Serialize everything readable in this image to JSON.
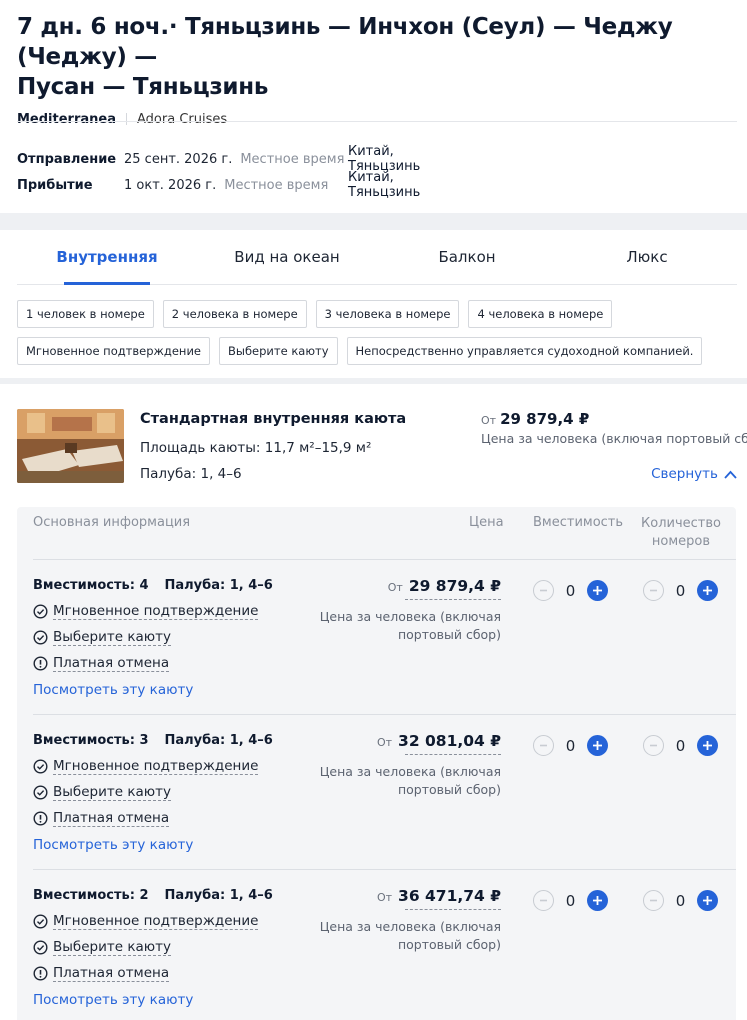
{
  "cruise": {
    "title_line1": "7 дн. 6 ноч.· Тяньцзинь — Инчхон (Сеул) — Чеджу (Чеджу) —",
    "title_line2": "Пусан — Тяньцзинь",
    "ship": "Mediterranea",
    "line": "Adora Cruises"
  },
  "schedule": {
    "departure": {
      "label": "Отправление",
      "date": "25 сент. 2026 г.",
      "time_note": "Местное время",
      "place": "Китай, Тяньцзинь"
    },
    "arrival": {
      "label": "Прибытие",
      "date": "1 окт. 2026 г.",
      "time_note": "Местное время",
      "place": "Китай, Тяньцзинь"
    }
  },
  "tabs": [
    "Внутренняя",
    "Вид на океан",
    "Балкон",
    "Люкс"
  ],
  "active_tab": 0,
  "filters": [
    "1 человек в номере",
    "2 человека в номере",
    "3 человека в номере",
    "4 человека в номере",
    "Мгновенное подтверждение",
    "Выберите каюту",
    "Непосредственно управляется судоходной компанией."
  ],
  "cabin": {
    "name": "Стандартная внутренняя каюта",
    "area": "Площадь каюты: 11,7 м²–15,9 м²",
    "deck": "Палуба: 1, 4–6",
    "price_prefix": "От",
    "price": "29 879,4 ₽",
    "price_note": "Цена за человека (включая портовый сбор)",
    "collapse_label": "Свернуть"
  },
  "table_headers": {
    "info": "Основная информация",
    "price": "Цена",
    "capacity": "Вместимость",
    "quantity": "Количество номеров"
  },
  "rates": [
    {
      "capacity": "Вместимость: 4",
      "deck": "Палуба: 1, 4–6",
      "features": [
        "Мгновенное подтверждение",
        "Выберите каюту",
        "Платная отмена"
      ],
      "view_label": "Посмотреть эту каюту",
      "price_prefix": "От",
      "price": "29 879,4 ₽",
      "price_note": "Цена за человека (включая портовый сбор)",
      "guests": "0",
      "rooms": "0"
    },
    {
      "capacity": "Вместимость: 3",
      "deck": "Палуба: 1, 4–6",
      "features": [
        "Мгновенное подтверждение",
        "Выберите каюту",
        "Платная отмена"
      ],
      "view_label": "Посмотреть эту каюту",
      "price_prefix": "От",
      "price": "32 081,04 ₽",
      "price_note": "Цена за человека (включая портовый сбор)",
      "guests": "0",
      "rooms": "0"
    },
    {
      "capacity": "Вместимость: 2",
      "deck": "Палуба: 1, 4–6",
      "features": [
        "Мгновенное подтверждение",
        "Выберите каюту",
        "Платная отмена"
      ],
      "view_label": "Посмотреть эту каюту",
      "price_prefix": "От",
      "price": "36 471,74 ₽",
      "price_note": "Цена за человека (включая портовый сбор)",
      "guests": "0",
      "rooms": "0"
    }
  ],
  "colors": {
    "accent": "#2563d8",
    "text": "#0f1a2e",
    "muted": "#8a909b",
    "panel": "#f4f5f7"
  }
}
